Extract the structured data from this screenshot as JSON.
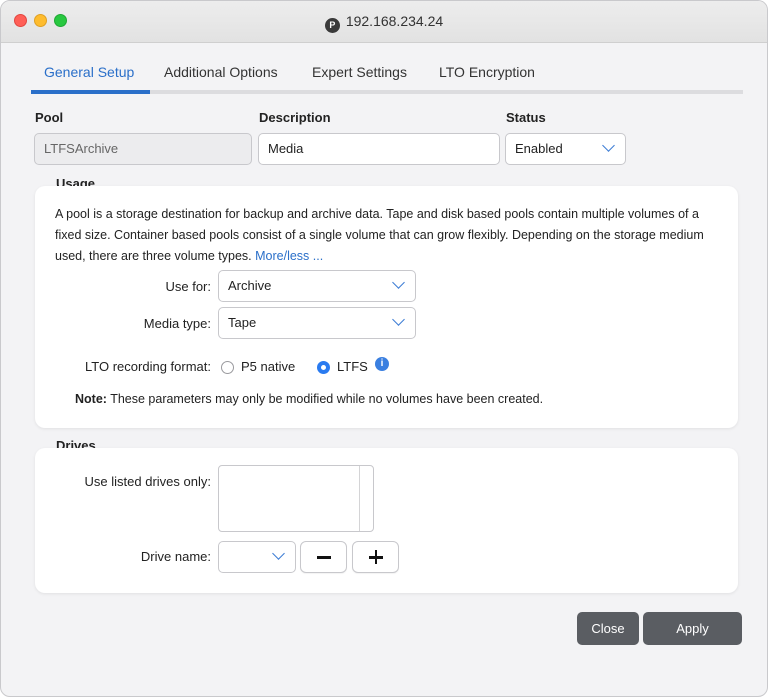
{
  "window": {
    "title": "192.168.234.24",
    "icon": "p5-app-icon"
  },
  "tabs": [
    {
      "label": "General Setup",
      "active": true
    },
    {
      "label": "Additional Options",
      "active": false
    },
    {
      "label": "Expert Settings",
      "active": false
    },
    {
      "label": "LTO Encryption",
      "active": false
    }
  ],
  "pool": {
    "label": "Pool",
    "value": "LTFSArchive"
  },
  "description": {
    "label": "Description",
    "value": "Media"
  },
  "status": {
    "label": "Status",
    "value": "Enabled"
  },
  "usage": {
    "title": "Usage",
    "text": "A pool is a storage destination for backup and archive data. Tape and disk based pools contain multiple volumes of a fixed size. Container based pools consist of a single volume that can grow flexibly. Depending on the storage medium used, there are three volume types.",
    "more_link": "More/less ...",
    "use_for_label": "Use for:",
    "use_for_value": "Archive",
    "media_type_label": "Media type:",
    "media_type_value": "Tape",
    "lto_format_label": "LTO recording format:",
    "lto_options": [
      {
        "label": "P5 native",
        "selected": false
      },
      {
        "label": "LTFS",
        "selected": true
      }
    ],
    "note_bold": "Note:",
    "note_text": "These parameters may only be modified while no volumes have been created."
  },
  "drives": {
    "title": "Drives",
    "listed_label": "Use listed drives only:",
    "drive_name_label": "Drive name:",
    "drive_name_value": ""
  },
  "buttons": {
    "close": "Close",
    "apply": "Apply"
  },
  "colors": {
    "accent": "#2a6fc9",
    "button": "#5a5d62"
  }
}
